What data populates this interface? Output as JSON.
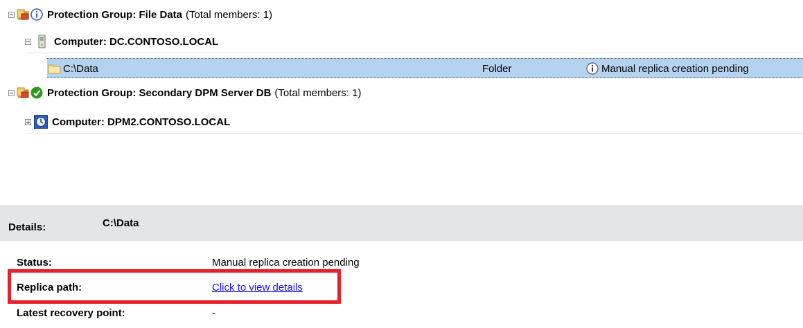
{
  "tree": {
    "group1": {
      "label": "Protection Group: File Data",
      "suffix": "(Total members: 1)"
    },
    "computer1": {
      "label": "Computer: DC.CONTOSO.LOCAL"
    },
    "item1": {
      "name": "C:\\Data",
      "type": "Folder",
      "status": "Manual replica creation pending"
    },
    "group2": {
      "label": "Protection Group: Secondary DPM Server DB",
      "suffix": "(Total members: 1)"
    },
    "computer2": {
      "label": "Computer: DPM2.CONTOSO.LOCAL"
    }
  },
  "details": {
    "label": "Details:",
    "value": "C:\\Data",
    "status_label": "Status:",
    "status_value": "Manual replica creation pending",
    "replica_label": "Replica path:",
    "replica_link": "Click to view details",
    "recovery_label": "Latest recovery point:",
    "recovery_value": "-"
  },
  "colors": {
    "selection": "#b5d3ef",
    "link": "#1a0dff",
    "highlight": "#e8202a",
    "status_ok": "#2e9b1d"
  }
}
